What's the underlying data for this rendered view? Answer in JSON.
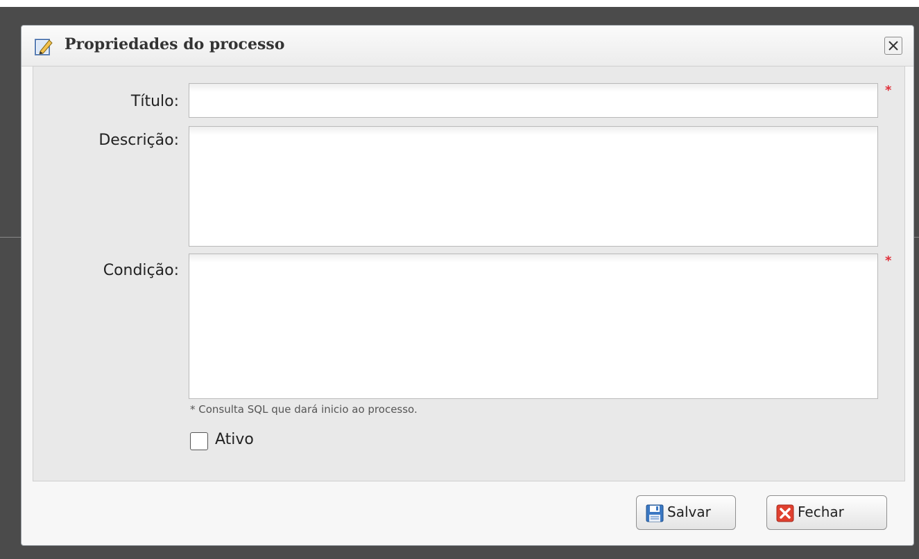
{
  "dialog": {
    "title": "Propriedades do processo",
    "title_icon": "edit-pencil-icon",
    "close_icon": "close-x-icon"
  },
  "form": {
    "titulo_label": "Título:",
    "titulo_value": "",
    "titulo_required": "*",
    "descricao_label": "Descrição:",
    "descricao_value": "",
    "condicao_label": "Condição:",
    "condicao_value": "",
    "condicao_required": "*",
    "condicao_hint": "* Consulta SQL que dará inicio ao processo.",
    "ativo_label": "Ativo",
    "ativo_checked": false
  },
  "buttons": {
    "save_label": "Salvar",
    "save_icon": "floppy-disk-icon",
    "close_label": "Fechar",
    "close_icon": "red-x-icon"
  },
  "colors": {
    "backdrop": "#4b4b4b",
    "panel": "#e9e9e9",
    "required": "#e0303a"
  }
}
